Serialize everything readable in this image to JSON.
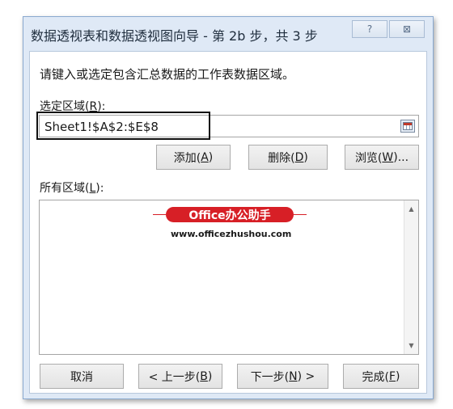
{
  "window": {
    "title": "数据透视表和数据透视图向导 - 第 2b 步，共 3 步",
    "help_label": "?",
    "close_label": "⊠"
  },
  "instruction": "请键入或选定包含汇总数据的工作表数据区域。",
  "select_range": {
    "label": "选定区域(R):",
    "value": "Sheet1!$A$2:$E$8",
    "collapse_icon": "range-collapse-icon"
  },
  "range_buttons": {
    "add": "添加(A)",
    "delete": "删除(D)",
    "browse": "浏览(W)..."
  },
  "all_ranges": {
    "label": "所有区域(L):",
    "items": []
  },
  "watermark": {
    "banner": "Office办公助手",
    "url": "www.officezhushou.com",
    "color": "#d71f26"
  },
  "footer_buttons": {
    "cancel": "取消",
    "prev": "< 上一步(B)",
    "next": "下一步(N) >",
    "finish": "完成(F)"
  }
}
